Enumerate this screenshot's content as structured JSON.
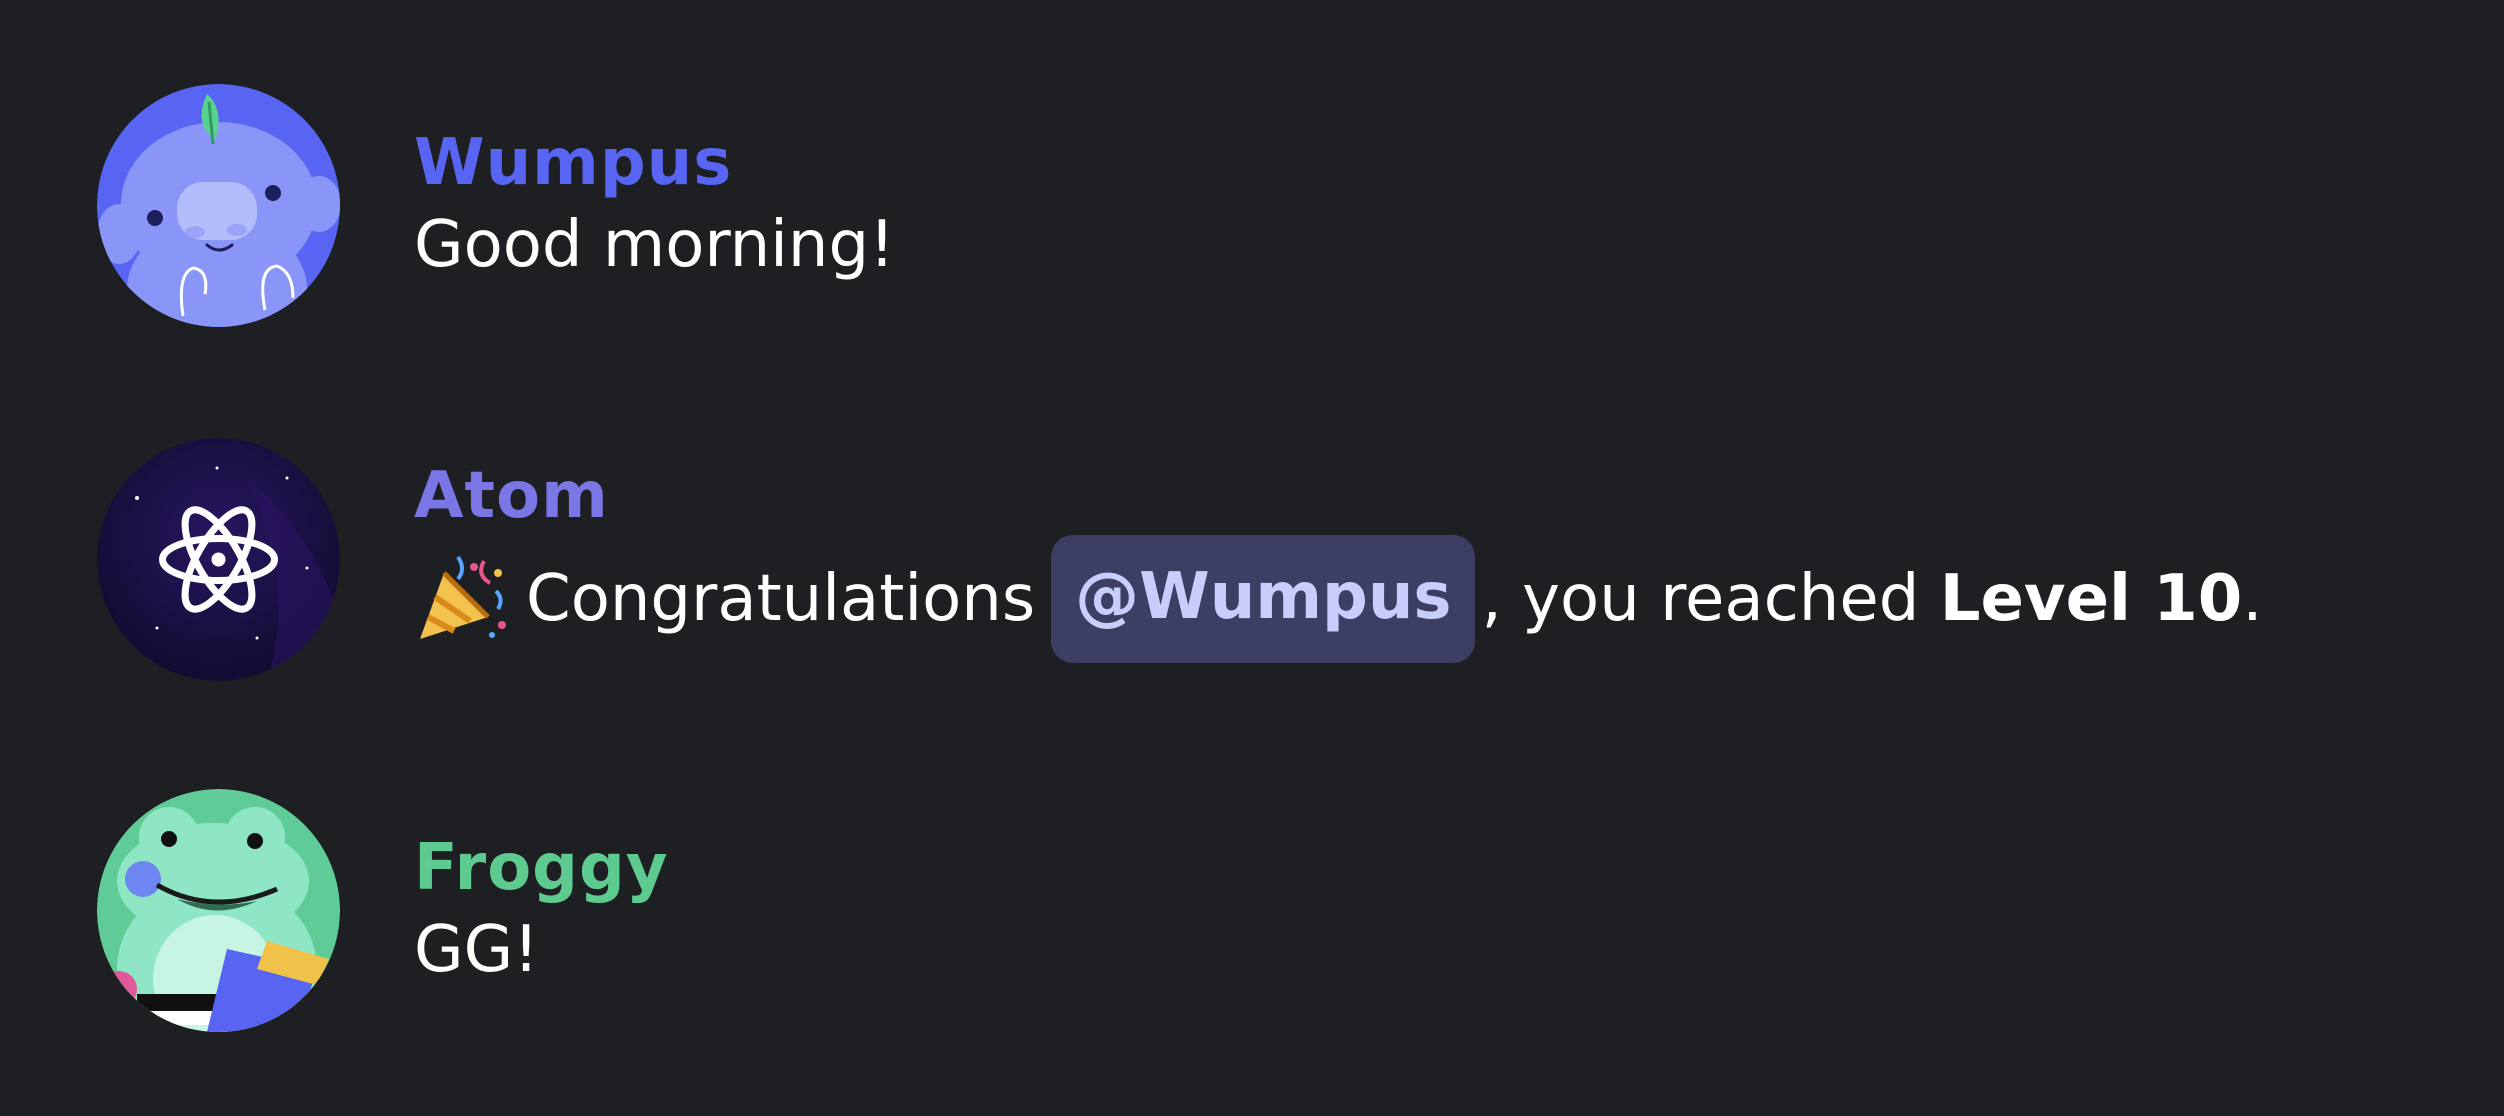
{
  "messages": [
    {
      "username": "Wumpus",
      "username_color": "#5865f2",
      "avatar": "wumpus-avatar",
      "text": "Good morning!"
    },
    {
      "username": "Atom",
      "username_color": "#7b76e6",
      "avatar": "atom-avatar",
      "emoji": "party-popper-emoji",
      "text_before": "Congratulations",
      "mention": "@Wumpus",
      "text_after": ", you reached ",
      "strong_text": "Level 10",
      "text_end": "."
    },
    {
      "username": "Froggy",
      "username_color": "#5dca90",
      "avatar": "froggy-avatar",
      "text": "GG!"
    }
  ],
  "colors": {
    "background": "#1e1f23",
    "mention_bg": "#3c3e63",
    "mention_text": "#c9cdfb"
  }
}
